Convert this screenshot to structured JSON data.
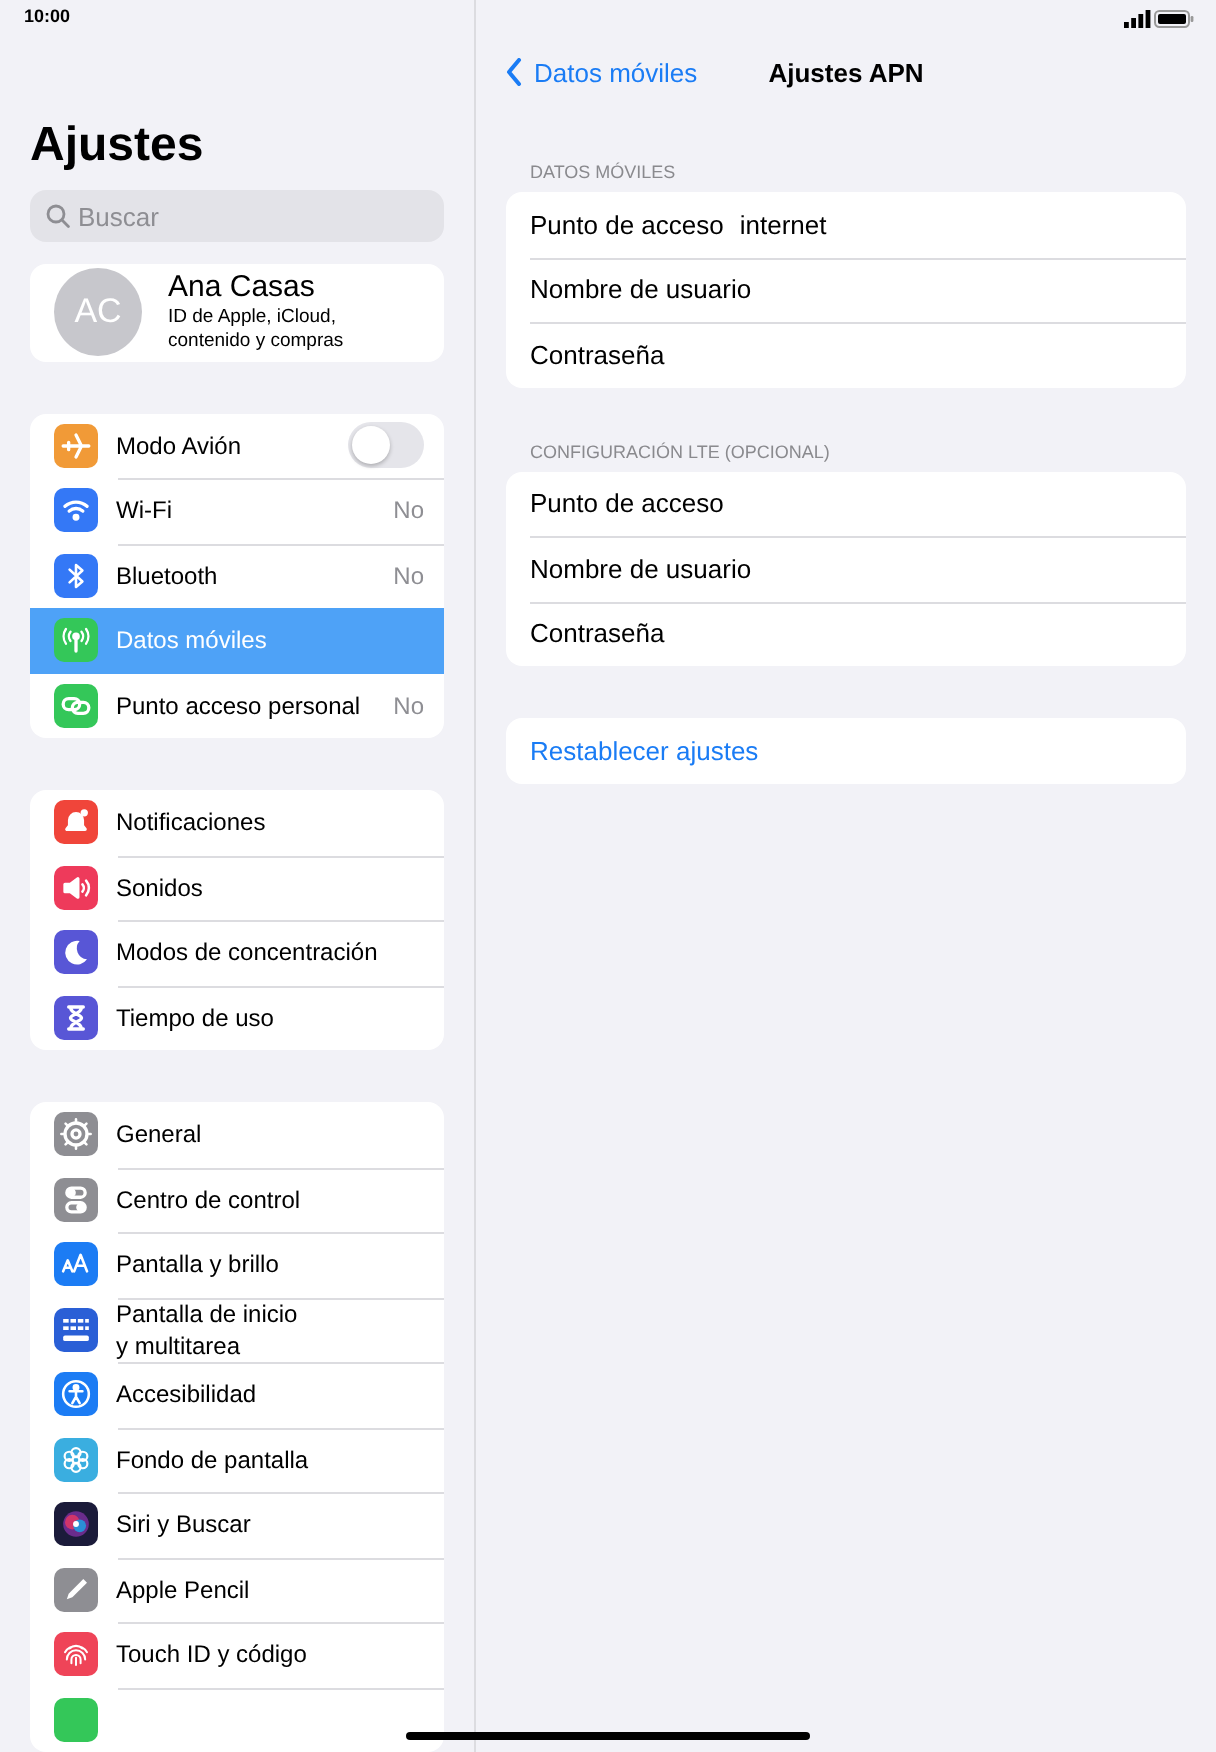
{
  "status_bar": {
    "time": "10:00"
  },
  "sidebar": {
    "title": "Ajustes",
    "search": {
      "placeholder": "Buscar"
    },
    "profile": {
      "initials": "AC",
      "name": "Ana Casas",
      "subtitle": "ID de Apple, iCloud,\ncontenido y compras"
    },
    "groups": [
      [
        {
          "kind": "airplane",
          "color": "#f19a37",
          "label": "Modo Avión",
          "toggle": {
            "on": false
          },
          "selected": false
        },
        {
          "kind": "wifi",
          "color": "#3478f6",
          "label": "Wi-Fi",
          "value": "No",
          "selected": false
        },
        {
          "kind": "bluetooth",
          "color": "#3478f6",
          "label": "Bluetooth",
          "value": "No",
          "selected": false
        },
        {
          "kind": "cellular",
          "color": "#34c759",
          "label": "Datos móviles",
          "selected": true
        },
        {
          "kind": "hotspot",
          "color": "#34c759",
          "label": "Punto acceso personal",
          "value": "No",
          "selected": false
        }
      ],
      [
        {
          "kind": "bell",
          "color": "#f0453a",
          "label": "Notificaciones",
          "selected": false
        },
        {
          "kind": "speaker",
          "color": "#ee3a5b",
          "label": "Sonidos",
          "selected": false
        },
        {
          "kind": "moon",
          "color": "#5856d6",
          "label": "Modos de concentración",
          "selected": false
        },
        {
          "kind": "hourglass",
          "color": "#5856d6",
          "label": "Tiempo de uso",
          "selected": false
        }
      ],
      [
        {
          "kind": "gear",
          "color": "#8e8e93",
          "label": "General",
          "selected": false
        },
        {
          "kind": "switches",
          "color": "#8e8e93",
          "label": "Centro de control",
          "selected": false
        },
        {
          "kind": "letters",
          "color": "#1c7cf4",
          "label": "Pantalla y brillo",
          "selected": false
        },
        {
          "kind": "grid",
          "color": "#2a5fd6",
          "label": "Pantalla de inicio\ny multitarea",
          "selected": false
        },
        {
          "kind": "person",
          "color": "#1c7cf4",
          "label": "Accesibilidad",
          "selected": false
        },
        {
          "kind": "flower",
          "color": "#3aaee0",
          "label": "Fondo de pantalla",
          "selected": false
        },
        {
          "kind": "orb",
          "color": "#1b1b3a",
          "label": "Siri y Buscar",
          "selected": false
        },
        {
          "kind": "pencil",
          "color": "#8e8e93",
          "label": "Apple Pencil",
          "selected": false
        },
        {
          "kind": "fingerprint",
          "color": "#ef4458",
          "label": "Touch ID y código",
          "selected": false
        },
        {
          "kind": "blank",
          "color": "#34c759",
          "selected": false
        }
      ]
    ]
  },
  "detail": {
    "back": "Datos móviles",
    "title": "Ajustes APN",
    "sections": [
      {
        "header": "DATOS MÓVILES",
        "rows": [
          {
            "label": "Punto de acceso",
            "value": "internet"
          },
          {
            "label": "Nombre de usuario"
          },
          {
            "label": "Contraseña"
          }
        ]
      },
      {
        "header": "CONFIGURACIÓN LTE (OPCIONAL)",
        "rows": [
          {
            "label": "Punto de acceso"
          },
          {
            "label": "Nombre de usuario"
          },
          {
            "label": "Contraseña"
          }
        ]
      }
    ],
    "reset": "Restablecer ajustes"
  }
}
